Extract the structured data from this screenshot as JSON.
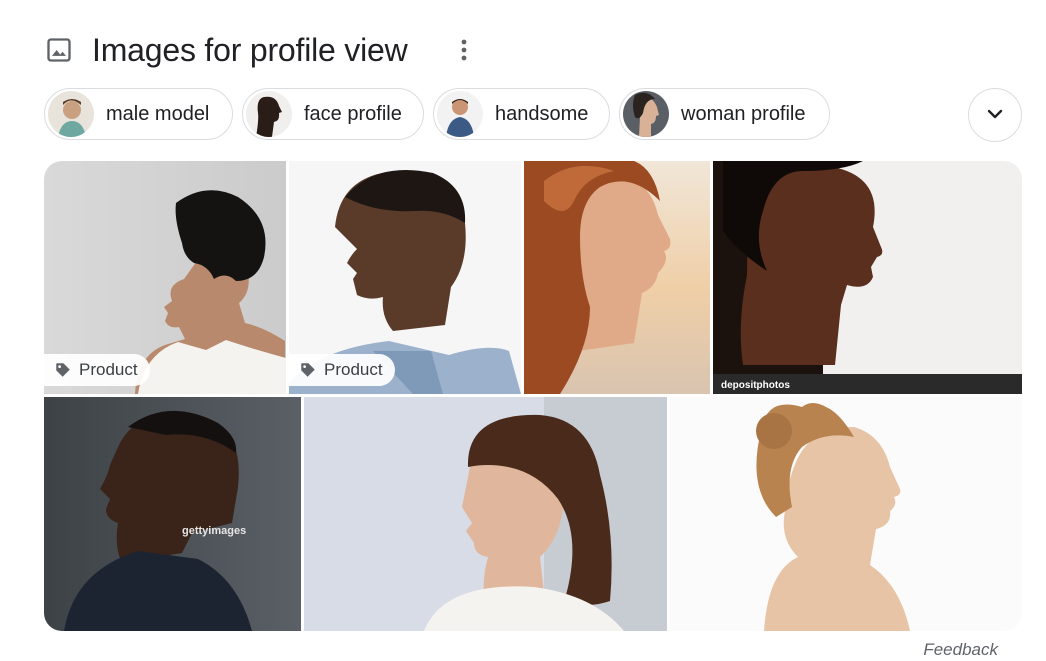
{
  "header": {
    "title": "Images for profile view",
    "icon": "image-icon",
    "more_icon": "more-vert-icon"
  },
  "chips": [
    {
      "label": "male model"
    },
    {
      "label": "face profile"
    },
    {
      "label": "handsome"
    },
    {
      "label": "woman profile"
    }
  ],
  "expand_icon": "chevron-down-icon",
  "images": [
    {
      "badge": "Product",
      "watermark": ""
    },
    {
      "badge": "Product",
      "watermark": ""
    },
    {
      "badge": "",
      "watermark": ""
    },
    {
      "badge": "",
      "watermark": "depositphotos"
    },
    {
      "badge": "",
      "watermark": "gettyimages"
    },
    {
      "badge": "",
      "watermark": ""
    },
    {
      "badge": "",
      "watermark": ""
    }
  ],
  "footer": {
    "feedback": "Feedback"
  },
  "colors": {
    "text": "#202124",
    "border": "#dadce0",
    "secondary": "#5f6368"
  }
}
